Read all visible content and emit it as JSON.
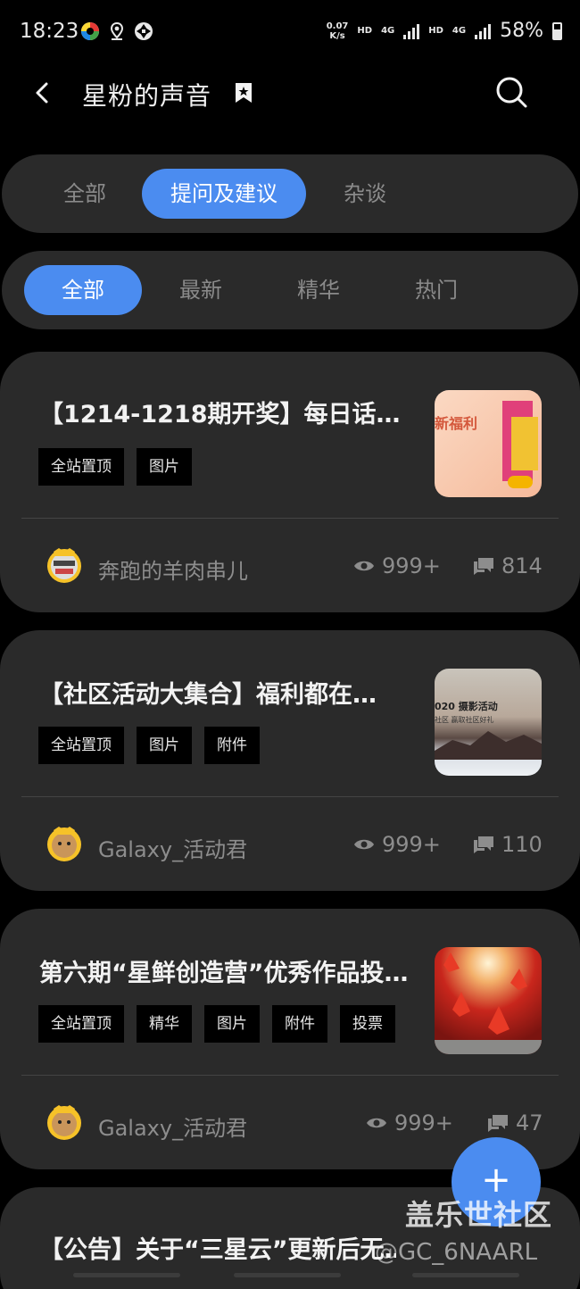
{
  "status_bar": {
    "time": "18:23",
    "net_speed_value": "0.07",
    "net_speed_unit": "K/s",
    "hd1": "HD",
    "hd2": "HD",
    "net1": "4G",
    "net2": "4G",
    "battery": "58%"
  },
  "header": {
    "title": "星粉的声音"
  },
  "top_tabs": [
    {
      "label": "全部",
      "active": false
    },
    {
      "label": "提问及建议",
      "active": true
    },
    {
      "label": "杂谈",
      "active": false
    }
  ],
  "sub_tabs": [
    {
      "label": "全部",
      "active": true
    },
    {
      "label": "最新",
      "active": false
    },
    {
      "label": "精华",
      "active": false
    },
    {
      "label": "热门",
      "active": false
    }
  ],
  "posts": [
    {
      "title": "【1214-1218期开奖】每日话…",
      "tags": [
        "全站置顶",
        "图片"
      ],
      "author": "奔跑的羊肉串儿",
      "views": "999+",
      "comments": "814",
      "thumb_text": "新福利"
    },
    {
      "title": "【社区活动大集合】福利都在…",
      "tags": [
        "全站置顶",
        "图片",
        "附件"
      ],
      "author": "Galaxy_活动君",
      "views": "999+",
      "comments": "110",
      "thumb_text": "020 摄影活动",
      "thumb_sub": "社区 赢取社区好礼"
    },
    {
      "title": "第六期“星鲜创造营”优秀作品投…",
      "tags": [
        "全站置顶",
        "精华",
        "图片",
        "附件",
        "投票"
      ],
      "author": "Galaxy_活动君",
      "views": "999+",
      "comments": "47"
    },
    {
      "title": "【公告】关于“三星云”更新后无…"
    }
  ],
  "fab": {
    "label": "+"
  },
  "watermark": {
    "text": "盖乐世社区",
    "sub": "@GC_6NAARL"
  },
  "colors": {
    "accent": "#4b8cf0",
    "card": "#2a2a2a",
    "background": "#000000"
  }
}
